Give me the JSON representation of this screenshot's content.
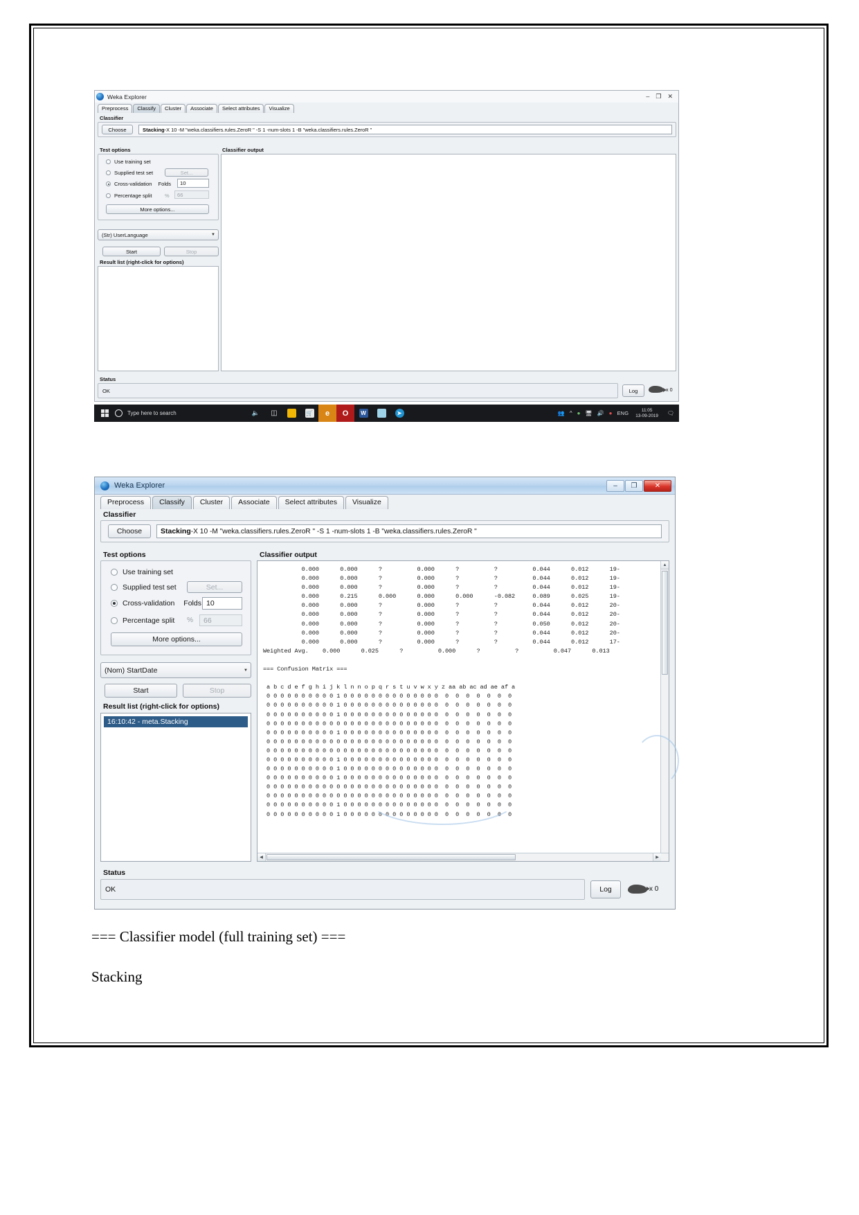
{
  "window1": {
    "title": "Weka Explorer",
    "title_buttons": [
      "–",
      "❐",
      "✕"
    ],
    "tabs": [
      {
        "label": "Preprocess",
        "active": false
      },
      {
        "label": "Classify",
        "active": true
      },
      {
        "label": "Cluster",
        "active": false
      },
      {
        "label": "Associate",
        "active": false
      },
      {
        "label": "Select attributes",
        "active": false
      },
      {
        "label": "Visualize",
        "active": false
      }
    ],
    "classifier": {
      "group_label": "Classifier",
      "choose_label": "Choose",
      "name": "Stacking",
      "options": " -X 10 -M \"weka.classifiers.rules.ZeroR \" -S 1 -num-slots 1 -B \"weka.classifiers.rules.ZeroR \""
    },
    "test_options": {
      "group_label": "Test options",
      "use_training_set": "Use training set",
      "supplied_test_set": "Supplied test set",
      "set_button": "Set...",
      "cross_validation": "Cross-validation",
      "folds_label": "Folds",
      "folds_value": "10",
      "percentage_split": "Percentage split",
      "percent_symbol": "%",
      "percent_value": "66",
      "more_options": "More options..."
    },
    "class_combo": "(Str) UserLanguage",
    "start_label": "Start",
    "stop_label": "Stop",
    "result_list_label": "Result list (right-click for options)",
    "classifier_output_label": "Classifier output",
    "status_label": "Status",
    "status_value": "OK",
    "log_label": "Log",
    "bird_count": "x 0"
  },
  "taskbar": {
    "search_placeholder": "Type here to search",
    "language": "ENG",
    "time": "11:05",
    "date": "13-09-2019",
    "apps": [
      {
        "name": "task-view",
        "glyph": "⧉",
        "color": "transparent"
      },
      {
        "name": "file-explorer",
        "glyph": "",
        "color": "#f6c141"
      },
      {
        "name": "microsoft-store",
        "glyph": "",
        "color": "#e9e9e9"
      },
      {
        "name": "microsoft-edge",
        "glyph": "e",
        "color": "#1b80c4"
      },
      {
        "name": "opera",
        "glyph": "O",
        "color": "#d81f26"
      },
      {
        "name": "microsoft-word",
        "glyph": "W",
        "color": "#2b579a"
      },
      {
        "name": "notepad",
        "glyph": "",
        "color": "#8ecae6"
      },
      {
        "name": "telegram",
        "glyph": "➤",
        "color": "#229ed9"
      }
    ]
  },
  "window2": {
    "title": "Weka Explorer",
    "minimize": "–",
    "maximize": "❐",
    "close": "✕",
    "tabs": [
      {
        "label": "Preprocess",
        "active": false
      },
      {
        "label": "Classify",
        "active": true
      },
      {
        "label": "Cluster",
        "active": false
      },
      {
        "label": "Associate",
        "active": false
      },
      {
        "label": "Select attributes",
        "active": false
      },
      {
        "label": "Visualize",
        "active": false
      }
    ],
    "classifier": {
      "group_label": "Classifier",
      "choose_label": "Choose",
      "name": "Stacking",
      "options": " -X 10 -M \"weka.classifiers.rules.ZeroR \" -S 1 -num-slots 1 -B \"weka.classifiers.rules.ZeroR \""
    },
    "test_options": {
      "group_label": "Test options",
      "use_training_set": "Use training set",
      "supplied_test_set": "Supplied test set",
      "set_button": "Set...",
      "cross_validation": "Cross-validation",
      "folds_label": "Folds",
      "folds_value": "10",
      "percentage_split": "Percentage split",
      "percent_symbol": "%",
      "percent_value": "66",
      "more_options": "More options..."
    },
    "class_combo": "(Nom) StartDate",
    "start_label": "Start",
    "stop_label": "Stop",
    "result_list_label": "Result list (right-click for options)",
    "result_items": [
      "16:10:42 - meta.Stacking"
    ],
    "classifier_output_label": "Classifier output",
    "status_label": "Status",
    "status_value": "OK",
    "log_label": "Log",
    "bird_count": "x 0",
    "output_text": "           0.000      0.000      ?          0.000      ?          ?          0.044      0.012      19-\n           0.000      0.000      ?          0.000      ?          ?          0.044      0.012      19-\n           0.000      0.000      ?          0.000      ?          ?          0.044      0.012      19-\n           0.000      0.215      0.000      0.000      0.000      -0.082     0.089      0.025      19-\n           0.000      0.000      ?          0.000      ?          ?          0.044      0.012      20-\n           0.000      0.000      ?          0.000      ?          ?          0.044      0.012      20-\n           0.000      0.000      ?          0.000      ?          ?          0.050      0.012      20-\n           0.000      0.000      ?          0.000      ?          ?          0.044      0.012      20-\n           0.000      0.000      ?          0.000      ?          ?          0.044      0.012      17-\nWeighted Avg.    0.000      0.025      ?          0.000      ?          ?          0.047      0.013\n\n=== Confusion Matrix ===\n\n a b c d e f g h i j k l n n o p q r s t u v w x y z aa ab ac ad ae af a\n 0 0 0 0 0 0 0 0 0 0 1 0 0 0 0 0 0 0 0 0 0 0 0 0 0  0  0  0  0  0  0  0\n 0 0 0 0 0 0 0 0 0 0 1 0 0 0 0 0 0 0 0 0 0 0 0 0 0  0  0  0  0  0  0  0\n 0 0 0 0 0 0 0 0 0 0 1 0 0 0 0 0 0 0 0 0 0 0 0 0 0  0  0  0  0  0  0  0\n 0 0 0 0 0 0 0 0 0 0 0 0 0 0 0 0 0 0 0 0 0 0 0 0 0  0  0  0  0  0  0  0\n 0 0 0 0 0 0 0 0 0 0 1 0 0 0 0 0 0 0 0 0 0 0 0 0 0  0  0  0  0  0  0  0\n 0 0 0 0 0 0 0 0 0 0 0 0 0 0 0 0 0 0 0 0 0 0 0 0 0  0  0  0  0  0  0  0\n 0 0 0 0 0 0 0 0 0 0 0 0 0 0 0 0 0 0 0 0 0 0 0 0 0  0  0  0  0  0  0  0\n 0 0 0 0 0 0 0 0 0 0 1 0 0 0 0 0 0 0 0 0 0 0 0 0 0  0  0  0  0  0  0  0\n 0 0 0 0 0 0 0 0 0 0 1 0 0 0 0 0 0 0 0 0 0 0 0 0 0  0  0  0  0  0  0  0\n 0 0 0 0 0 0 0 0 0 0 1 0 0 0 0 0 0 0 0 0 0 0 0 0 0  0  0  0  0  0  0  0\n 0 0 0 0 0 0 0 0 0 0 0 0 0 0 0 0 0 0 0 0 0 0 0 0 0  0  0  0  0  0  0  0\n 0 0 0 0 0 0 0 0 0 0 0 0 0 0 0 0 0 0 0 0 0 0 0 0 0  0  0  0  0  0  0  0\n 0 0 0 0 0 0 0 0 0 0 1 0 0 0 0 0 0 0 0 0 0 0 0 0 0  0  0  0  0  0  0  0\n 0 0 0 0 0 0 0 0 0 0 1 0 0 0 0 0 0 0 0 0 0 0 0 0 0  0  0  0  0  0  0  0",
    "confusion_header": "=== Confusion Matrix ==="
  },
  "captions": {
    "line1": "=== Classifier model (full training set) ===",
    "line2": "Stacking"
  }
}
